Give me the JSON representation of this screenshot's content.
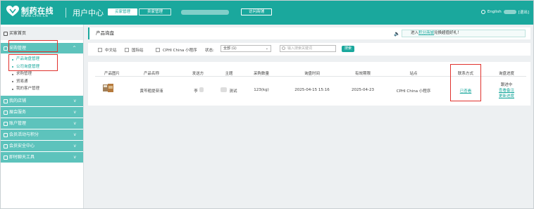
{
  "header": {
    "logo_text": "制药在线",
    "logo_sub": "WWW.CPHI.CN",
    "title": "用户中心",
    "tab_buyer": "买家管理",
    "tab_seller": "卖家管理",
    "visit_shop": "访问商铺",
    "language": "English",
    "logout": "[退出]"
  },
  "sidebar": {
    "home": "买家首页",
    "sections": [
      {
        "label": "采购管理",
        "chevron": "^",
        "items": [
          {
            "label": "产品询盘管理",
            "active": true
          },
          {
            "label": "公司询盘管理",
            "active": true
          },
          {
            "label": "求购管理",
            "active": false
          },
          {
            "label": "贸易通",
            "active": false
          },
          {
            "label": "我的客户管理",
            "active": false
          }
        ]
      },
      {
        "label": "我的店铺",
        "chevron": "v"
      },
      {
        "label": "展会服务",
        "chevron": "v"
      },
      {
        "label": "账户管理",
        "chevron": "v"
      },
      {
        "label": "会员活动与积分",
        "chevron": "v"
      },
      {
        "label": "会员安全中心",
        "chevron": "v"
      },
      {
        "label": "即时聊天工具",
        "chevron": "v"
      }
    ]
  },
  "main": {
    "title": "产品询盘",
    "notice_pre": "进入",
    "notice_link": "积分商城",
    "notice_post": "兑换超值好礼！",
    "filters": {
      "cb1": "中文站",
      "cb2": "国际站",
      "cb3": "CPHI China 小程序",
      "status_label": "状态:",
      "status_value": "全部 (1)",
      "search_placeholder": "输入搜索关键词",
      "search_button": "搜索"
    },
    "table": {
      "headers": [
        "产品图片",
        "产品名称",
        "发送方",
        "主题",
        "采购数量",
        "询盘时间",
        "有效期限",
        "站点",
        "联系方式",
        "询盘进度"
      ],
      "rows": [
        {
          "product": "黄芩粗提苷液",
          "sender": "李",
          "subject": "测试",
          "quantity": "123(kg)",
          "time": "2025-04-15 15:16",
          "expiry": "2025-04-23",
          "site": "CPHI China 小程序",
          "contact": "已查看",
          "progress": "跟进中",
          "action1": "查看备注",
          "action2": "更新进度"
        }
      ]
    }
  },
  "colors": {
    "accent": "#1aa89d",
    "nav": "#5dc3bc",
    "highlight": "#e0322d"
  }
}
